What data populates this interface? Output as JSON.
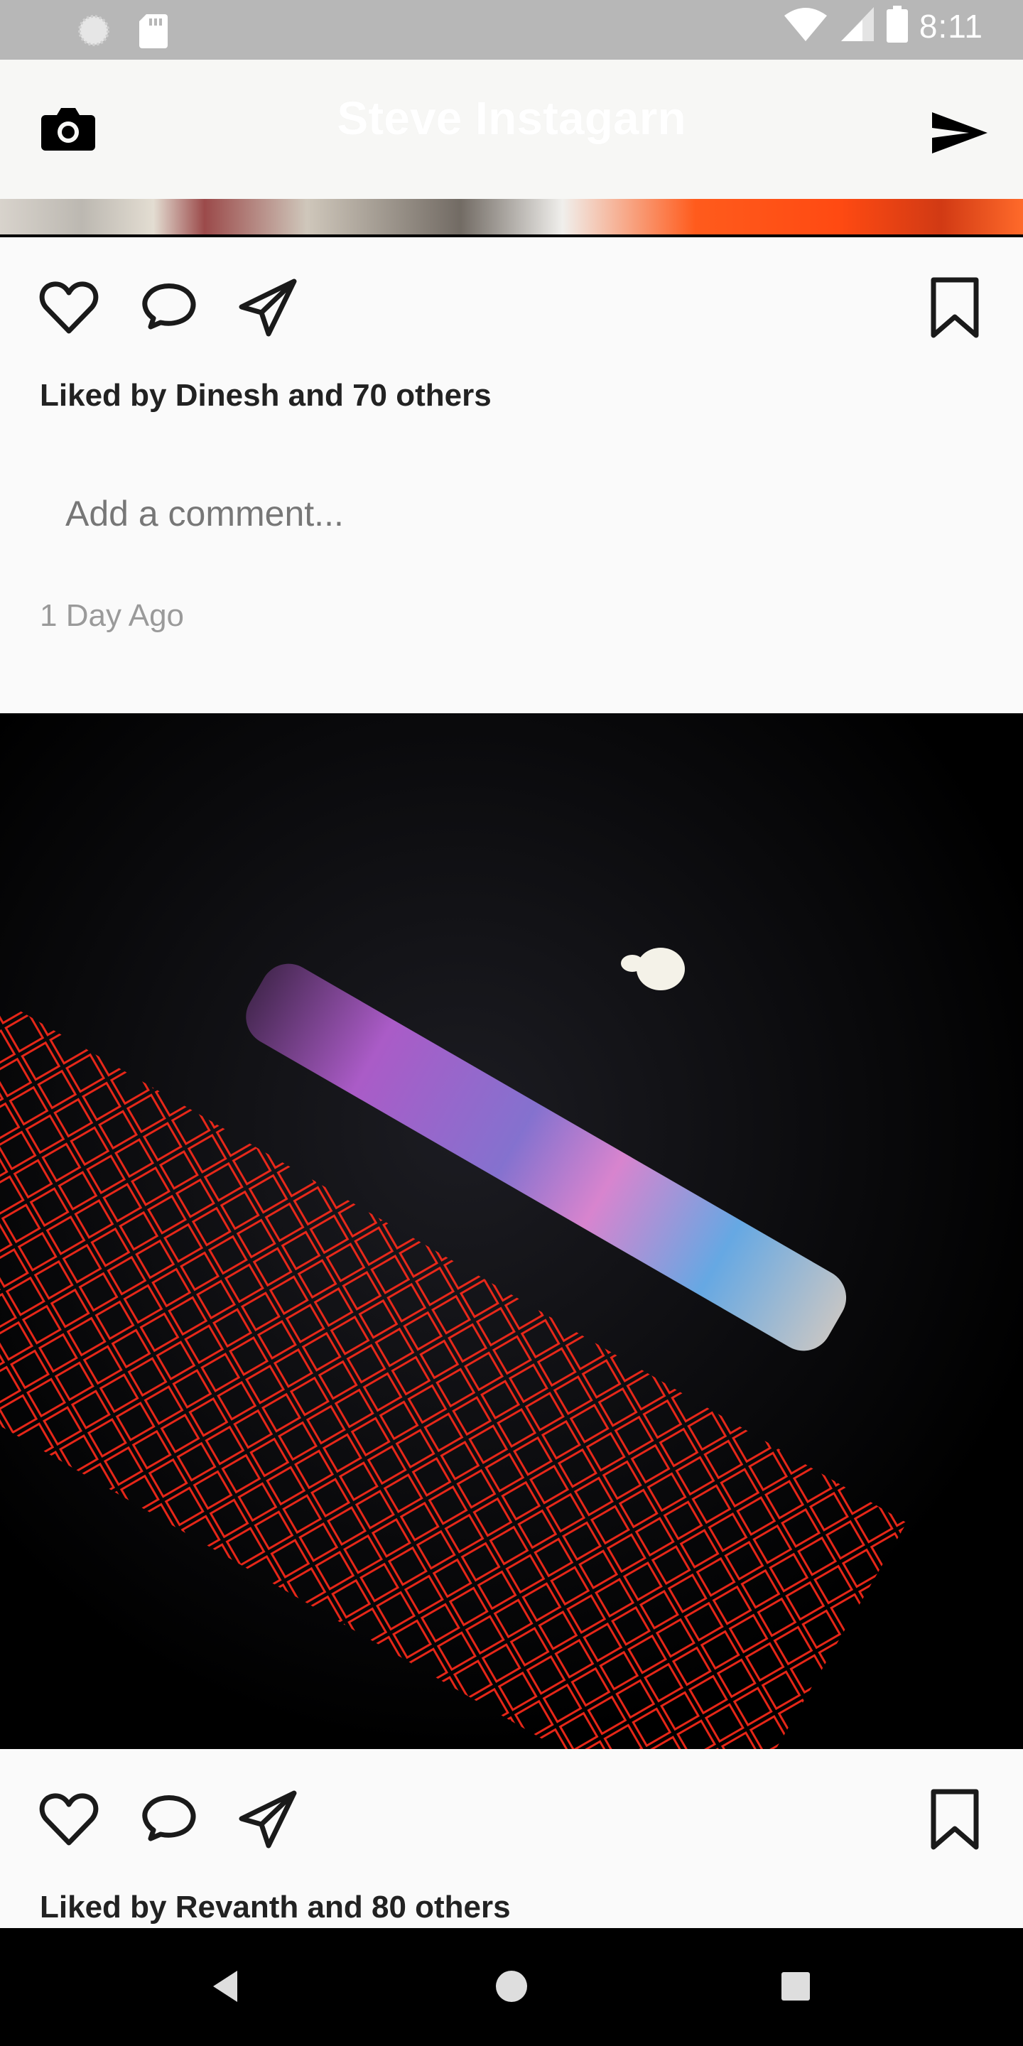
{
  "status_bar": {
    "time": "8:11",
    "icons": [
      "loading-icon",
      "sd-card-icon",
      "wifi-icon",
      "signal-icon",
      "battery-icon"
    ]
  },
  "app_bar": {
    "title": "Steve Instagarn",
    "left_icon": "camera-icon",
    "right_icon": "send-icon"
  },
  "posts": [
    {
      "likes_text": "Liked by Dinesh and 70 others",
      "comment_placeholder": "Add a comment...",
      "timestamp": "1 Day Ago"
    },
    {
      "likes_text": "Liked by Revanth and 80 others"
    }
  ],
  "nav_bar": {
    "buttons": [
      "back-icon",
      "home-icon",
      "recents-icon"
    ]
  },
  "colors": {
    "status_bar_bg": "#b7b7b7",
    "app_bar_bg": "#f7f7f5",
    "background": "#fafafa",
    "text_primary": "#222222",
    "text_secondary": "#9a9a9a",
    "nav_bar_bg": "#000000"
  }
}
